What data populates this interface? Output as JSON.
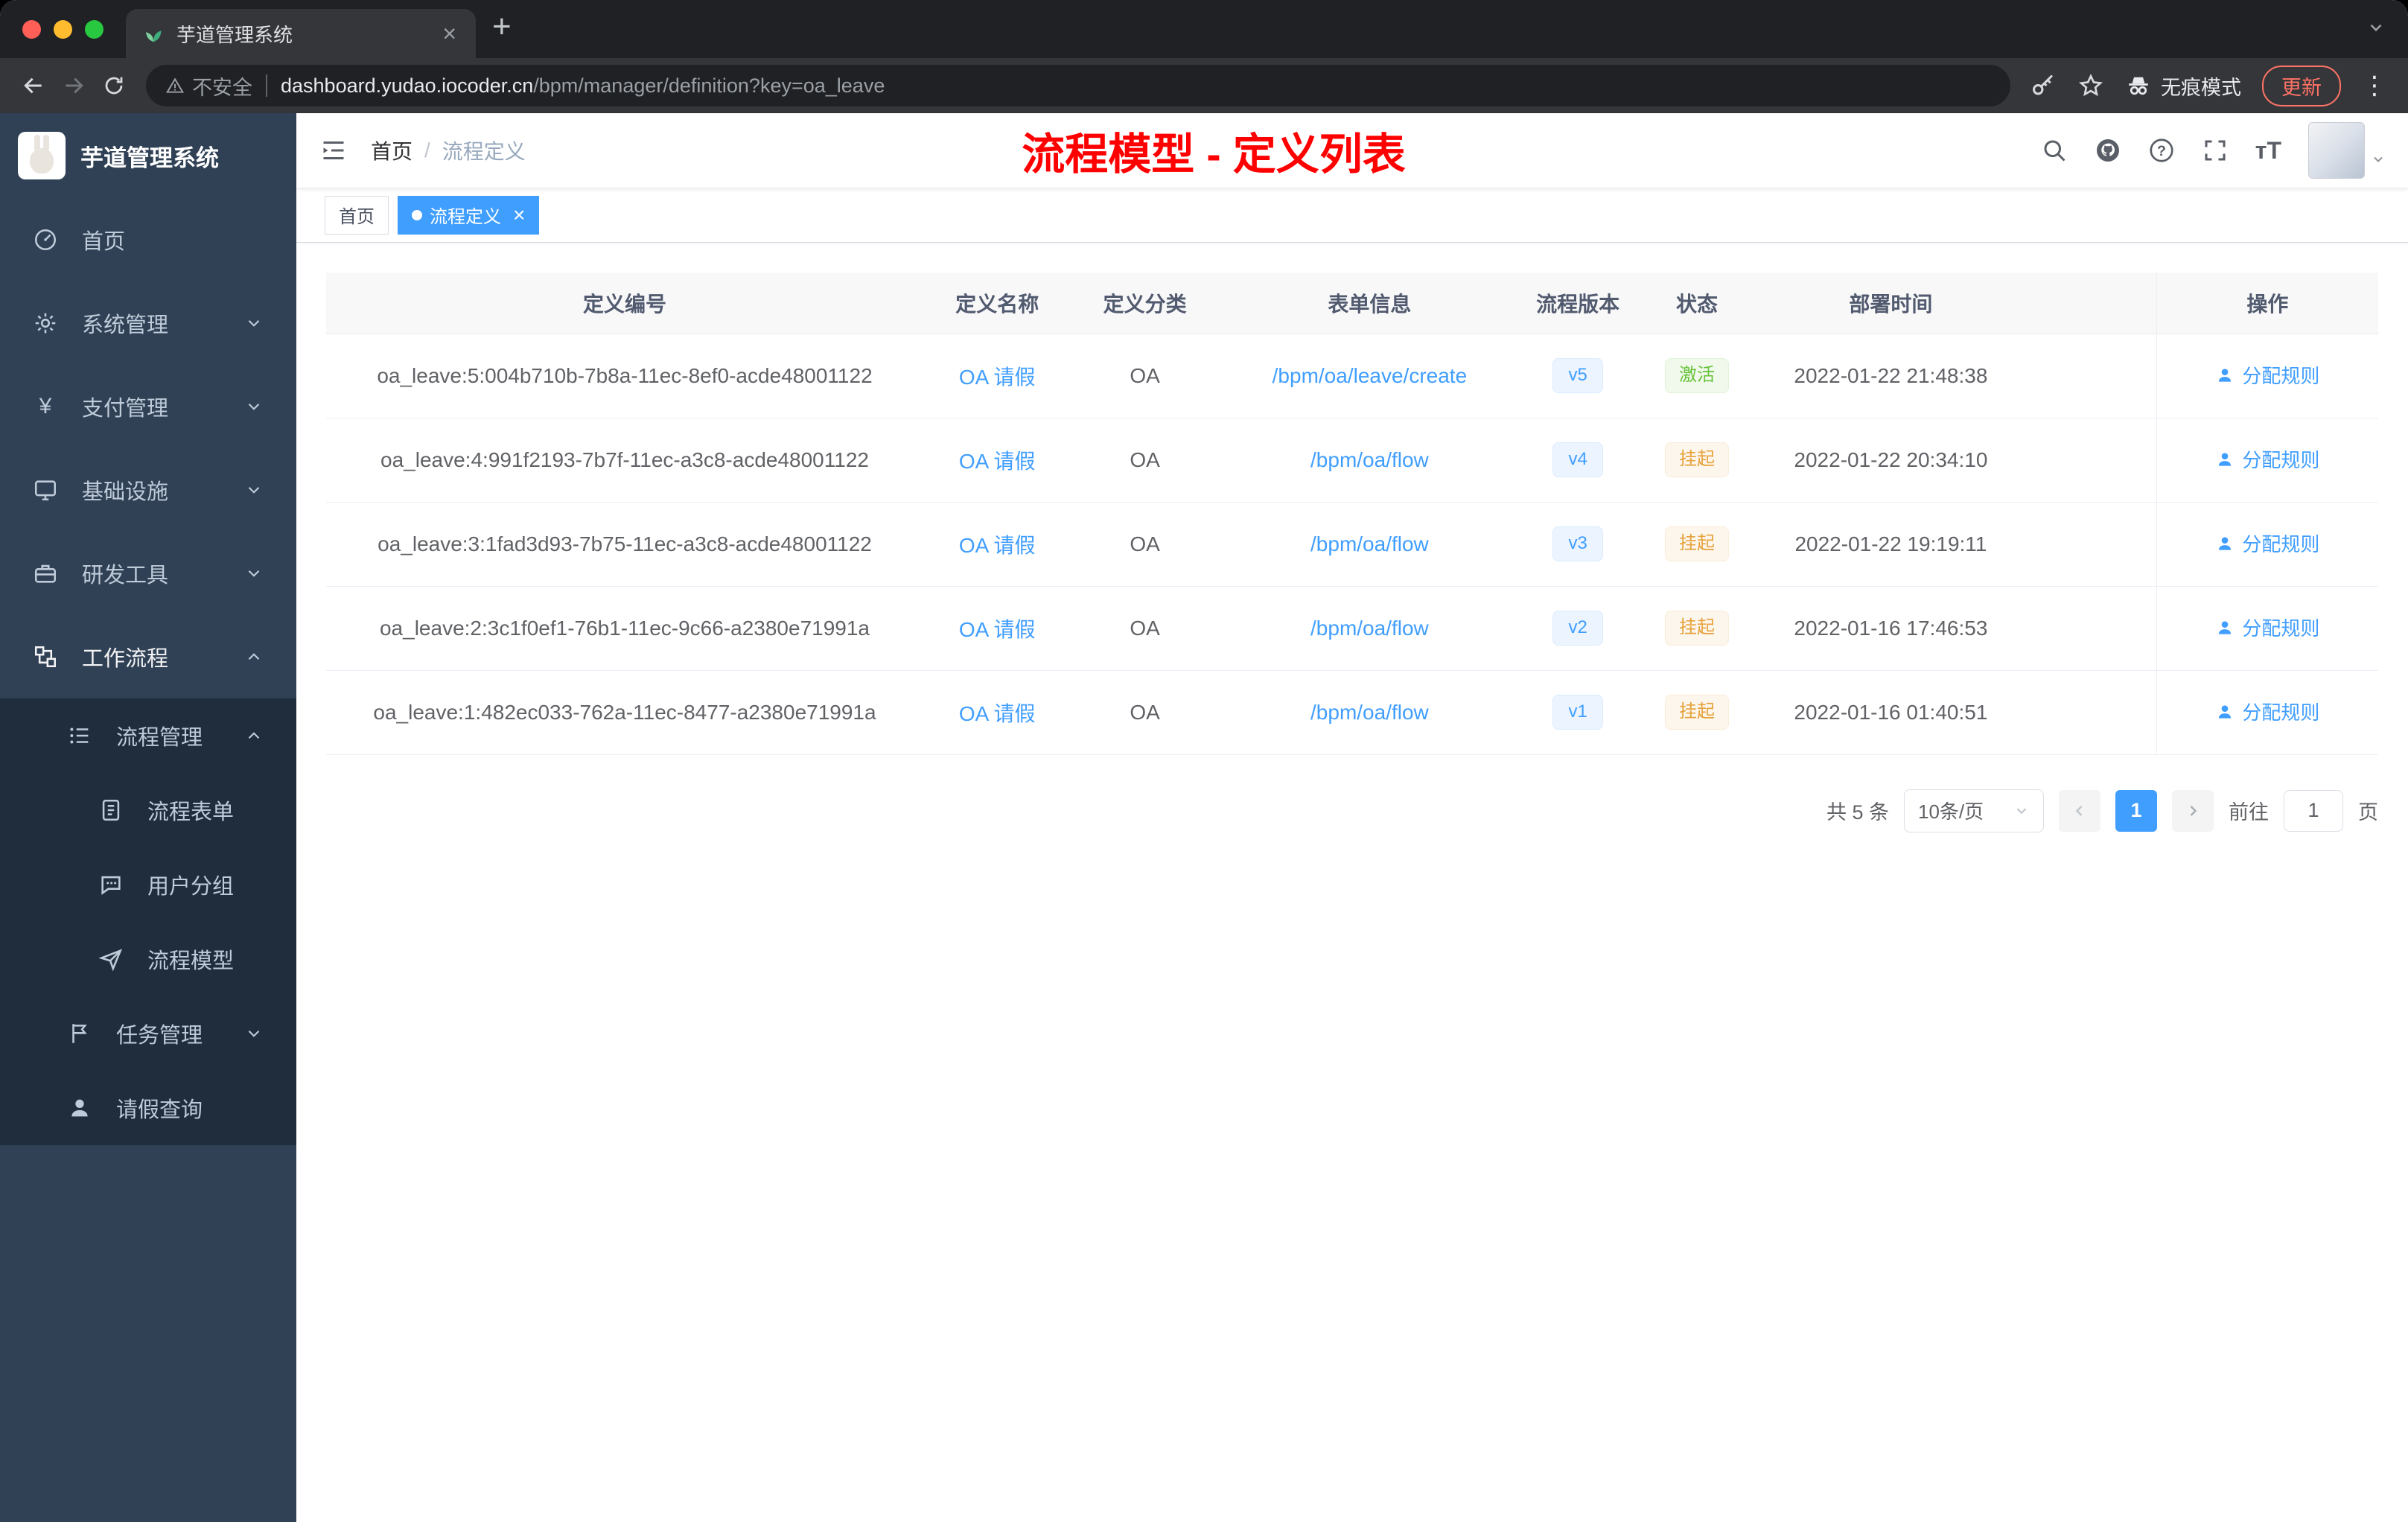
{
  "browser": {
    "tab": {
      "title": "芋道管理系统"
    },
    "address": {
      "security": "不安全",
      "host": "dashboard.yudao.iocoder.cn",
      "path": "/bpm/manager/definition?key=oa_leave"
    },
    "incognito": "无痕模式",
    "update": "更新"
  },
  "sidebar": {
    "logo": "芋道管理系统",
    "items": [
      {
        "label": "首页"
      },
      {
        "label": "系统管理"
      },
      {
        "label": "支付管理"
      },
      {
        "label": "基础设施"
      },
      {
        "label": "研发工具"
      },
      {
        "label": "工作流程"
      }
    ],
    "manage": {
      "label": "流程管理"
    },
    "manage_children": [
      {
        "label": "流程表单"
      },
      {
        "label": "用户分组"
      },
      {
        "label": "流程模型"
      }
    ],
    "task": {
      "label": "任务管理"
    },
    "leave": {
      "label": "请假查询"
    }
  },
  "navbar": {
    "breadcrumb": [
      "首页",
      "流程定义"
    ],
    "title": "流程模型 - 定义列表"
  },
  "tags": [
    {
      "label": "首页"
    },
    {
      "label": "流程定义"
    }
  ],
  "table": {
    "headers": [
      "定义编号",
      "定义名称",
      "定义分类",
      "表单信息",
      "流程版本",
      "状态",
      "部署时间",
      "操作"
    ],
    "rows": [
      {
        "id": "oa_leave:5:004b710b-7b8a-11ec-8ef0-acde48001122",
        "name": "OA 请假",
        "category": "OA",
        "form": "/bpm/oa/leave/create",
        "version": "v5",
        "status": "激活",
        "status_type": "success",
        "time": "2022-01-22 21:48:38",
        "action": "分配规则"
      },
      {
        "id": "oa_leave:4:991f2193-7b7f-11ec-a3c8-acde48001122",
        "name": "OA 请假",
        "category": "OA",
        "form": "/bpm/oa/flow",
        "version": "v4",
        "status": "挂起",
        "status_type": "warning",
        "time": "2022-01-22 20:34:10",
        "action": "分配规则"
      },
      {
        "id": "oa_leave:3:1fad3d93-7b75-11ec-a3c8-acde48001122",
        "name": "OA 请假",
        "category": "OA",
        "form": "/bpm/oa/flow",
        "version": "v3",
        "status": "挂起",
        "status_type": "warning",
        "time": "2022-01-22 19:19:11",
        "action": "分配规则"
      },
      {
        "id": "oa_leave:2:3c1f0ef1-76b1-11ec-9c66-a2380e71991a",
        "name": "OA 请假",
        "category": "OA",
        "form": "/bpm/oa/flow",
        "version": "v2",
        "status": "挂起",
        "status_type": "warning",
        "time": "2022-01-16 17:46:53",
        "action": "分配规则"
      },
      {
        "id": "oa_leave:1:482ec033-762a-11ec-8477-a2380e71991a",
        "name": "OA 请假",
        "category": "OA",
        "form": "/bpm/oa/flow",
        "version": "v1",
        "status": "挂起",
        "status_type": "warning",
        "time": "2022-01-16 01:40:51",
        "action": "分配规则"
      }
    ]
  },
  "pagination": {
    "total": "共 5 条",
    "page_size": "10条/页",
    "current": "1",
    "goto_label": "前往",
    "goto_value": "1",
    "goto_unit": "页"
  },
  "colors": {
    "accent": "#409eff",
    "sidebar_bg": "#304156",
    "submenu_bg": "#1f2d3d",
    "success": "#67c23a",
    "warning": "#e6a23c",
    "annotation": "#ff0000"
  }
}
